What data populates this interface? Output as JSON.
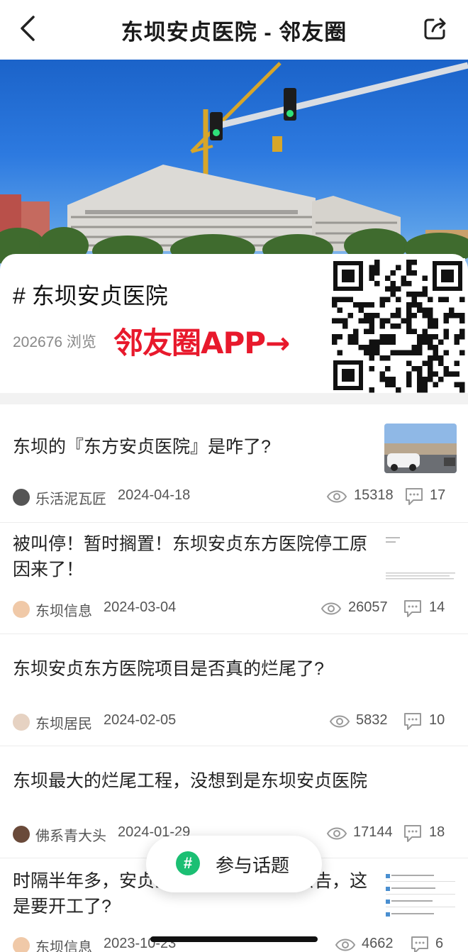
{
  "header": {
    "title": "东坝安贞医院 - 邻友圈",
    "back_icon": "chevron-left-icon",
    "share_icon": "share-icon"
  },
  "topic": {
    "name": "# 东坝安贞医院",
    "views": "202676 浏览",
    "promo": "邻友圈APP→"
  },
  "posts": [
    {
      "title": "东坝的『东方安贞医院』是咋了?",
      "author": "乐活泥瓦匠",
      "date": "2024-04-18",
      "views": "15318",
      "comments": "17"
    },
    {
      "title": "被叫停！暂时搁置！东坝安贞东方医院停工原因来了！",
      "author": "东坝信息",
      "date": "2024-03-04",
      "views": "26057",
      "comments": "14"
    },
    {
      "title": "东坝安贞东方医院项目是否真的烂尾了?",
      "author": "东坝居民",
      "date": "2024-02-05",
      "views": "5832",
      "comments": "10"
    },
    {
      "title": "东坝最大的烂尾工程，没想到是东坝安贞医院",
      "author": "佛系青大头",
      "date": "2024-01-29",
      "views": "17144",
      "comments": "18"
    },
    {
      "title": "时隔半年多，安贞医院东院项目发布公告，这是要开工了?",
      "author": "东坝信息",
      "date": "2023-10-23",
      "views": "4662",
      "comments": "6"
    }
  ],
  "floating": {
    "label": "参与话题",
    "icon": "#"
  },
  "colors": {
    "accent": "#1bbf73",
    "promo_red": "#e8192c"
  }
}
